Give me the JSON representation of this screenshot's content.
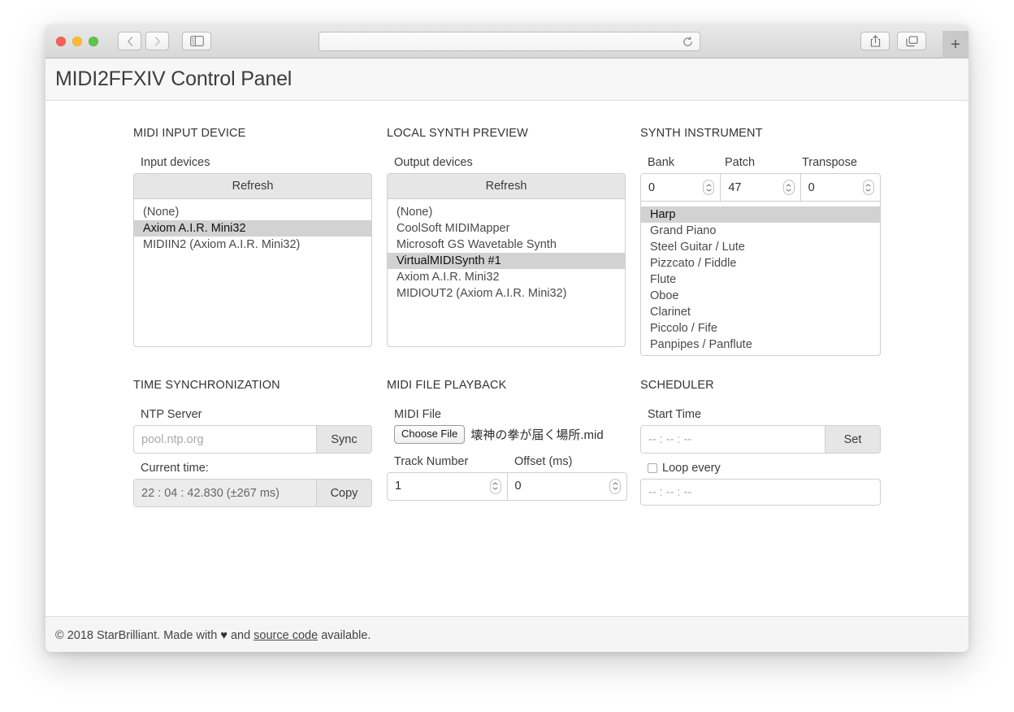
{
  "browser": {
    "url_value": "",
    "reload_icon": "reload-icon",
    "back_icon": "chevron-left-icon",
    "forward_icon": "chevron-right-icon",
    "sidebar_icon": "sidebar-toggle-icon",
    "share_icon": "share-icon",
    "tabs_icon": "show-tabs-icon",
    "new_tab_label": "+"
  },
  "header": {
    "title": "MIDI2FFXIV Control Panel"
  },
  "midi_input": {
    "section_title": "MIDI INPUT DEVICE",
    "label": "Input devices",
    "refresh_label": "Refresh",
    "devices": [
      {
        "name": "(None)",
        "selected": false
      },
      {
        "name": "Axiom A.I.R. Mini32",
        "selected": true
      },
      {
        "name": "MIDIIN2 (Axiom A.I.R. Mini32)",
        "selected": false
      }
    ]
  },
  "local_synth": {
    "section_title": "LOCAL SYNTH PREVIEW",
    "label": "Output devices",
    "refresh_label": "Refresh",
    "devices": [
      {
        "name": "(None)",
        "selected": false
      },
      {
        "name": "CoolSoft MIDIMapper",
        "selected": false
      },
      {
        "name": "Microsoft GS Wavetable Synth",
        "selected": false
      },
      {
        "name": "VirtualMIDISynth #1",
        "selected": true
      },
      {
        "name": "Axiom A.I.R. Mini32",
        "selected": false
      },
      {
        "name": "MIDIOUT2 (Axiom A.I.R. Mini32)",
        "selected": false
      }
    ]
  },
  "synth_instrument": {
    "section_title": "SYNTH INSTRUMENT",
    "bank_label": "Bank",
    "bank_value": "0",
    "patch_label": "Patch",
    "patch_value": "47",
    "transpose_label": "Transpose",
    "transpose_value": "0",
    "instruments": [
      {
        "name": "Harp",
        "selected": true
      },
      {
        "name": "Grand Piano",
        "selected": false
      },
      {
        "name": "Steel Guitar / Lute",
        "selected": false
      },
      {
        "name": "Pizzcato / Fiddle",
        "selected": false
      },
      {
        "name": "Flute",
        "selected": false
      },
      {
        "name": "Oboe",
        "selected": false
      },
      {
        "name": "Clarinet",
        "selected": false
      },
      {
        "name": "Piccolo / Fife",
        "selected": false
      },
      {
        "name": "Panpipes / Panflute",
        "selected": false
      }
    ]
  },
  "time_sync": {
    "section_title": "TIME SYNCHRONIZATION",
    "ntp_label": "NTP Server",
    "ntp_placeholder": "pool.ntp.org",
    "ntp_value": "",
    "sync_label": "Sync",
    "current_time_label": "Current time:",
    "current_time_value": "22 : 04 : 42.830 (±267 ms)",
    "copy_label": "Copy"
  },
  "midi_playback": {
    "section_title": "MIDI FILE PLAYBACK",
    "file_label": "MIDI File",
    "choose_file_label": "Choose File",
    "file_name": "壊神の拳が届く場所.mid",
    "track_label": "Track Number",
    "track_value": "1",
    "offset_label": "Offset (ms)",
    "offset_value": "0"
  },
  "scheduler": {
    "section_title": "SCHEDULER",
    "start_time_label": "Start Time",
    "start_time_placeholder": "-- : -- : --",
    "start_time_value": "",
    "set_label": "Set",
    "loop_label": "Loop every",
    "loop_checked": false,
    "loop_placeholder": "-- : -- : --",
    "loop_value": ""
  },
  "footer": {
    "text_before": "© 2018 StarBrilliant. Made with ",
    "heart": "♥",
    "text_middle": " and ",
    "link": "source code",
    "text_after": " available."
  }
}
